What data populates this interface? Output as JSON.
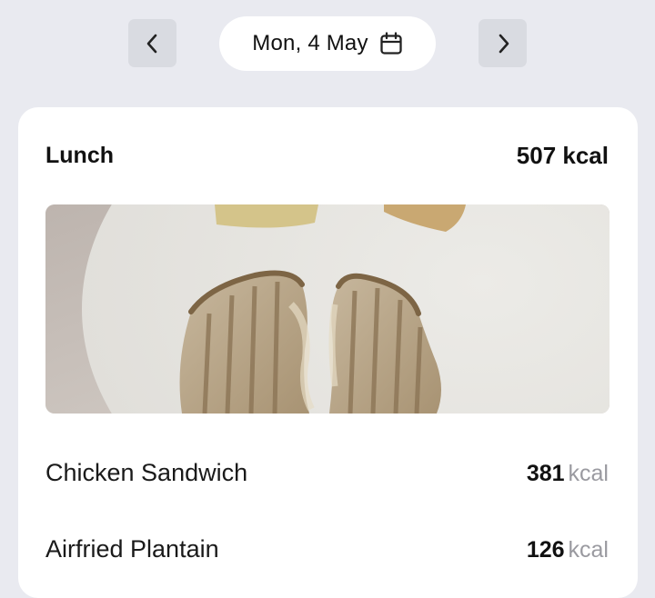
{
  "date_nav": {
    "prev_icon": "chevron-left-icon",
    "date_label": "Mon, 4 May",
    "calendar_icon": "calendar-icon",
    "next_icon": "chevron-right-icon"
  },
  "meal": {
    "title": "Lunch",
    "total_kcal": "507 kcal",
    "photo": "sandwich-plate-photo",
    "items": [
      {
        "name": "Chicken Sandwich",
        "kcal": "381",
        "unit": "kcal"
      },
      {
        "name": "Airfried Plantain",
        "kcal": "126",
        "unit": "kcal"
      }
    ]
  },
  "colors": {
    "background": "#e9eaf0",
    "card": "#ffffff",
    "nav_button": "#d9dbe1",
    "muted_text": "#9a9aa0"
  }
}
